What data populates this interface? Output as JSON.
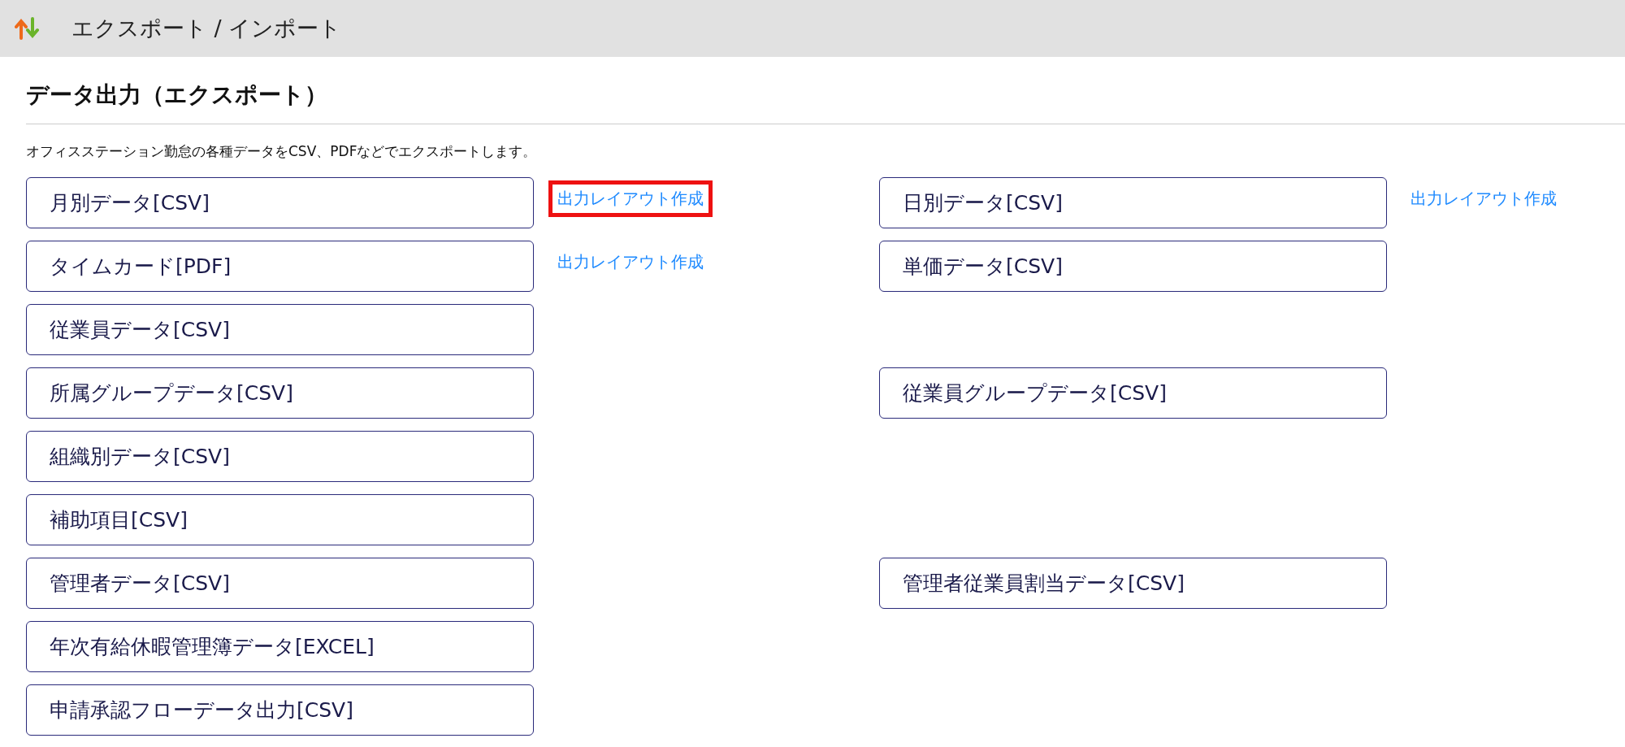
{
  "header": {
    "title": "エクスポート / インポート"
  },
  "page": {
    "heading": "データ出力（エクスポート）",
    "description": "オフィスステーション勤怠の各種データをCSV、PDFなどでエクスポートします。"
  },
  "rows": [
    {
      "left": {
        "label": "月別データ[CSV]",
        "link": {
          "text": "出力レイアウト作成",
          "highlighted": true
        }
      },
      "right": {
        "label": "日別データ[CSV]",
        "link": {
          "text": "出力レイアウト作成",
          "highlighted": false
        }
      }
    },
    {
      "left": {
        "label": "タイムカード[PDF]",
        "link": {
          "text": "出力レイアウト作成",
          "highlighted": false
        }
      },
      "right": {
        "label": "単価データ[CSV]"
      }
    },
    {
      "left": {
        "label": "従業員データ[CSV]"
      }
    },
    {
      "left": {
        "label": "所属グループデータ[CSV]"
      },
      "right": {
        "label": "従業員グループデータ[CSV]"
      }
    },
    {
      "left": {
        "label": "組織別データ[CSV]"
      }
    },
    {
      "left": {
        "label": "補助項目[CSV]"
      }
    },
    {
      "left": {
        "label": "管理者データ[CSV]"
      },
      "right": {
        "label": "管理者従業員割当データ[CSV]"
      }
    },
    {
      "left": {
        "label": "年次有給休暇管理簿データ[EXCEL]"
      }
    },
    {
      "left": {
        "label": "申請承認フローデータ出力[CSV]"
      }
    }
  ]
}
